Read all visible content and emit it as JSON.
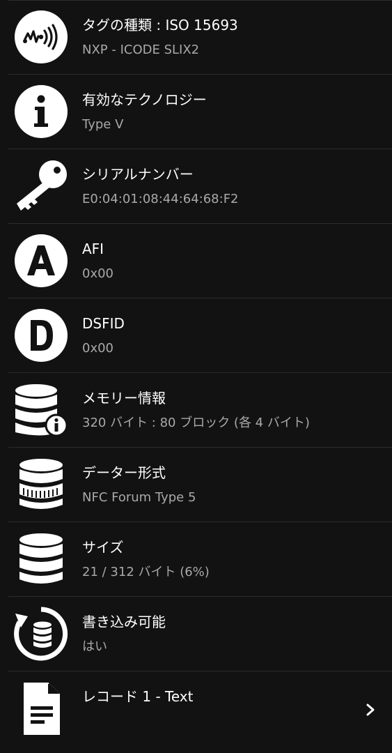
{
  "rows": [
    {
      "title": "タグの種類 : ISO 15693",
      "subtitle": "NXP - ICODE SLIX2",
      "icon": "nfc-wave-icon"
    },
    {
      "title": "有効なテクノロジー",
      "subtitle": "Type V",
      "icon": "info-icon"
    },
    {
      "title": "シリアルナンバー",
      "subtitle": "E0:04:01:08:44:64:68:F2",
      "icon": "key-icon"
    },
    {
      "title": "AFI",
      "subtitle": "0x00",
      "icon": "letter-a-icon"
    },
    {
      "title": "DSFID",
      "subtitle": "0x00",
      "icon": "letter-d-icon"
    },
    {
      "title": "メモリー情報",
      "subtitle": "320 バイト : 80 ブロック (各 4 バイト)",
      "icon": "database-info-icon"
    },
    {
      "title": "データー形式",
      "subtitle": "NFC Forum Type 5",
      "icon": "database-format-icon"
    },
    {
      "title": "サイズ",
      "subtitle": "21 / 312 バイト (6%)",
      "icon": "database-icon"
    },
    {
      "title": "書き込み可能",
      "subtitle": "はい",
      "icon": "database-refresh-icon"
    },
    {
      "title": "レコード 1 - Text",
      "subtitle": "",
      "icon": "document-icon"
    }
  ],
  "colors": {
    "background": "#121212",
    "divider": "#2c2c2c",
    "title": "#ffffff",
    "subtitle": "#a9a9a9"
  }
}
